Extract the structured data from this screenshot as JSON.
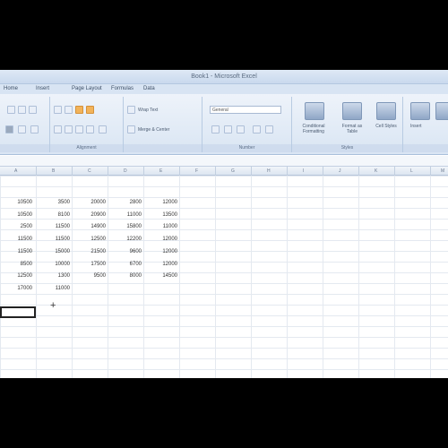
{
  "window": {
    "title": "Book1 - Microsoft Excel"
  },
  "menu": [
    "Home",
    "Insert",
    "Page Layout",
    "Formulas",
    "Data"
  ],
  "ribbon": {
    "wrap_text": "Wrap Text",
    "merge_center": "Merge & Center",
    "number_format": "General",
    "conditional_formatting": "Conditional Formatting",
    "format_as_table": "Format as Table",
    "cell_styles": "Cell Styles",
    "insert": "Insert",
    "groups": {
      "alignment": "Alignment",
      "number": "Number",
      "styles": "Styles"
    }
  },
  "formula_bar": {
    "name_box": ""
  },
  "columns": [
    "A",
    "B",
    "C",
    "D",
    "E",
    "F",
    "G",
    "H",
    "I",
    "J",
    "K",
    "L",
    "M"
  ],
  "sheet": {
    "headers": [
      "",
      "",
      "",
      "",
      "",
      "",
      ""
    ],
    "rows": [
      [
        "10500",
        "3500",
        "20000",
        "2800",
        "12000"
      ],
      [
        "10500",
        "8100",
        "20900",
        "11000",
        "13500"
      ],
      [
        "2500",
        "11500",
        "14900",
        "15800",
        "11000"
      ],
      [
        "11500",
        "11500",
        "12500",
        "12200",
        "12000"
      ],
      [
        "11500",
        "15000",
        "21500",
        "9600",
        "12000"
      ],
      [
        "8500",
        "10000",
        "17500",
        "6700",
        "12000"
      ],
      [
        "12500",
        "1300",
        "9500",
        "8000",
        "14500"
      ],
      [
        "17000",
        "11000",
        "",
        "",
        ""
      ]
    ],
    "totals": [
      "",
      ""
    ]
  }
}
